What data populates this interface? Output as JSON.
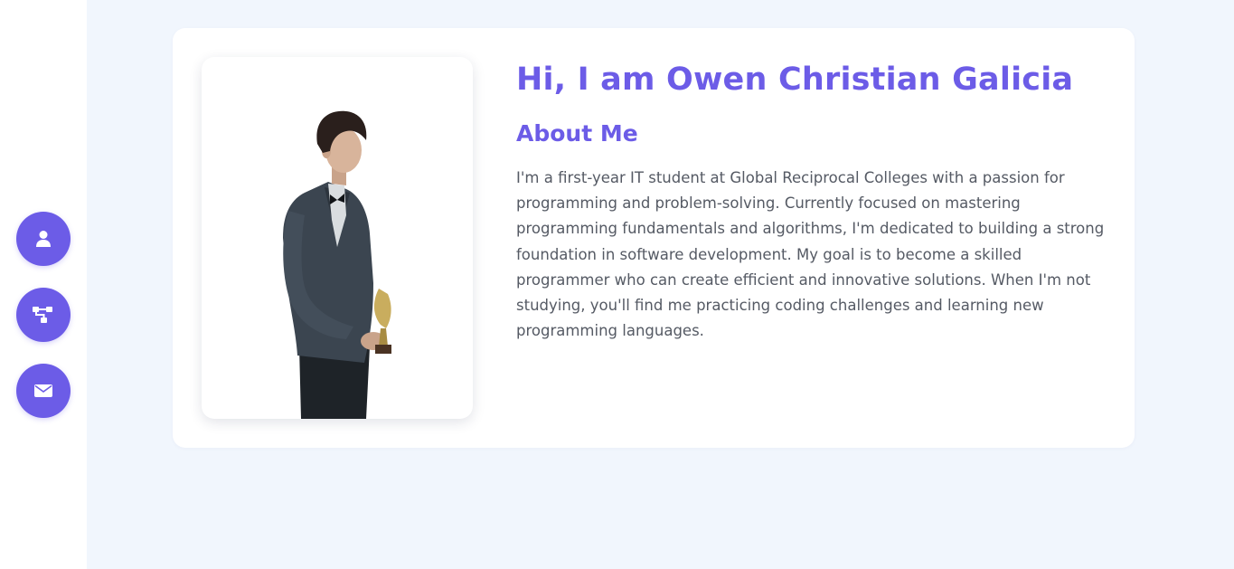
{
  "sidebar": {
    "items": [
      {
        "name": "about",
        "icon": "user-icon"
      },
      {
        "name": "skills",
        "icon": "sitemap-icon"
      },
      {
        "name": "contact",
        "icon": "envelope-icon"
      }
    ]
  },
  "profile": {
    "heading": "Hi, I am Owen Christian Galicia",
    "about_title": "About Me",
    "bio": "I'm a first-year IT student at Global Reciprocal Colleges with a passion for programming and problem-solving. Currently focused on mastering programming fundamentals and algorithms, I'm dedicated to building a strong foundation in software development. My goal is to become a skilled programmer who can create efficient and innovative solutions. When I'm not studying, you'll find me practicing coding challenges and learning new programming languages."
  },
  "colors": {
    "accent": "#6c5ce7",
    "background": "#f1f6fd",
    "text": "#555a64"
  }
}
